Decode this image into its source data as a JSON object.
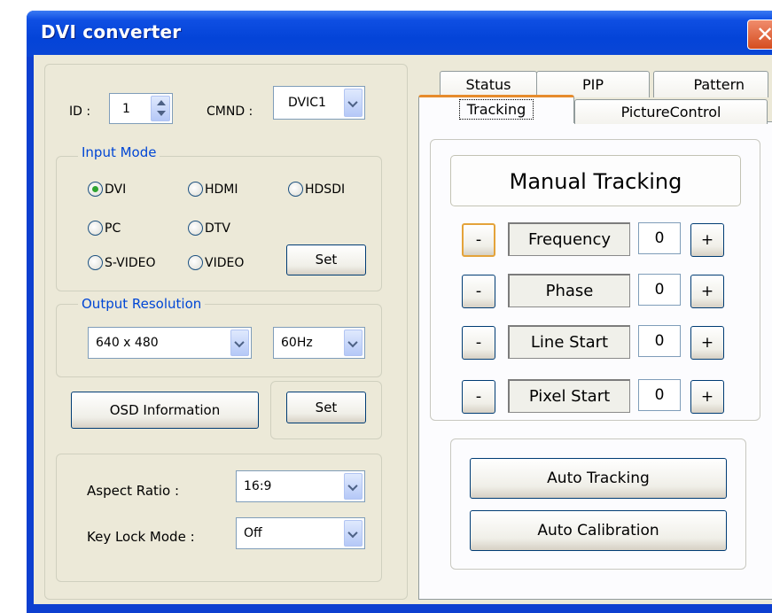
{
  "window": {
    "title": "DVI converter",
    "close_glyph": "✕"
  },
  "id_row": {
    "id_label": "ID :",
    "id_value": "1",
    "cmnd_label": "CMND :",
    "cmnd_value": "DVIC1"
  },
  "input_mode": {
    "title": "Input Mode",
    "options": [
      {
        "label": "DVI",
        "selected": true
      },
      {
        "label": "HDMI",
        "selected": false
      },
      {
        "label": "HDSDI",
        "selected": false
      },
      {
        "label": "PC",
        "selected": false
      },
      {
        "label": "DTV",
        "selected": false
      },
      {
        "label": "S-VIDEO",
        "selected": false
      },
      {
        "label": "VIDEO",
        "selected": false
      }
    ],
    "set_label": "Set"
  },
  "output_resolution": {
    "title": "Output Resolution",
    "resolution": "640 x 480",
    "refresh": "60Hz"
  },
  "osd": {
    "info_label": "OSD  Information",
    "set_label": "Set"
  },
  "aspect": {
    "aspect_label": "Aspect Ratio :",
    "aspect_value": "16:9",
    "keylock_label": "Key Lock Mode :",
    "keylock_value": "Off"
  },
  "tabs": {
    "row1": [
      "Status",
      "PIP",
      "Pattern"
    ],
    "row2": [
      "Tracking",
      "PictureControl"
    ],
    "active": "Tracking"
  },
  "tracking": {
    "header": "Manual Tracking",
    "minus": "-",
    "plus": "+",
    "rows": [
      {
        "label": "Frequency",
        "value": "0"
      },
      {
        "label": "Phase",
        "value": "0"
      },
      {
        "label": "Line Start",
        "value": "0"
      },
      {
        "label": "Pixel Start",
        "value": "0"
      }
    ],
    "auto_tracking": "Auto Tracking",
    "auto_calibration": "Auto Calibration"
  }
}
